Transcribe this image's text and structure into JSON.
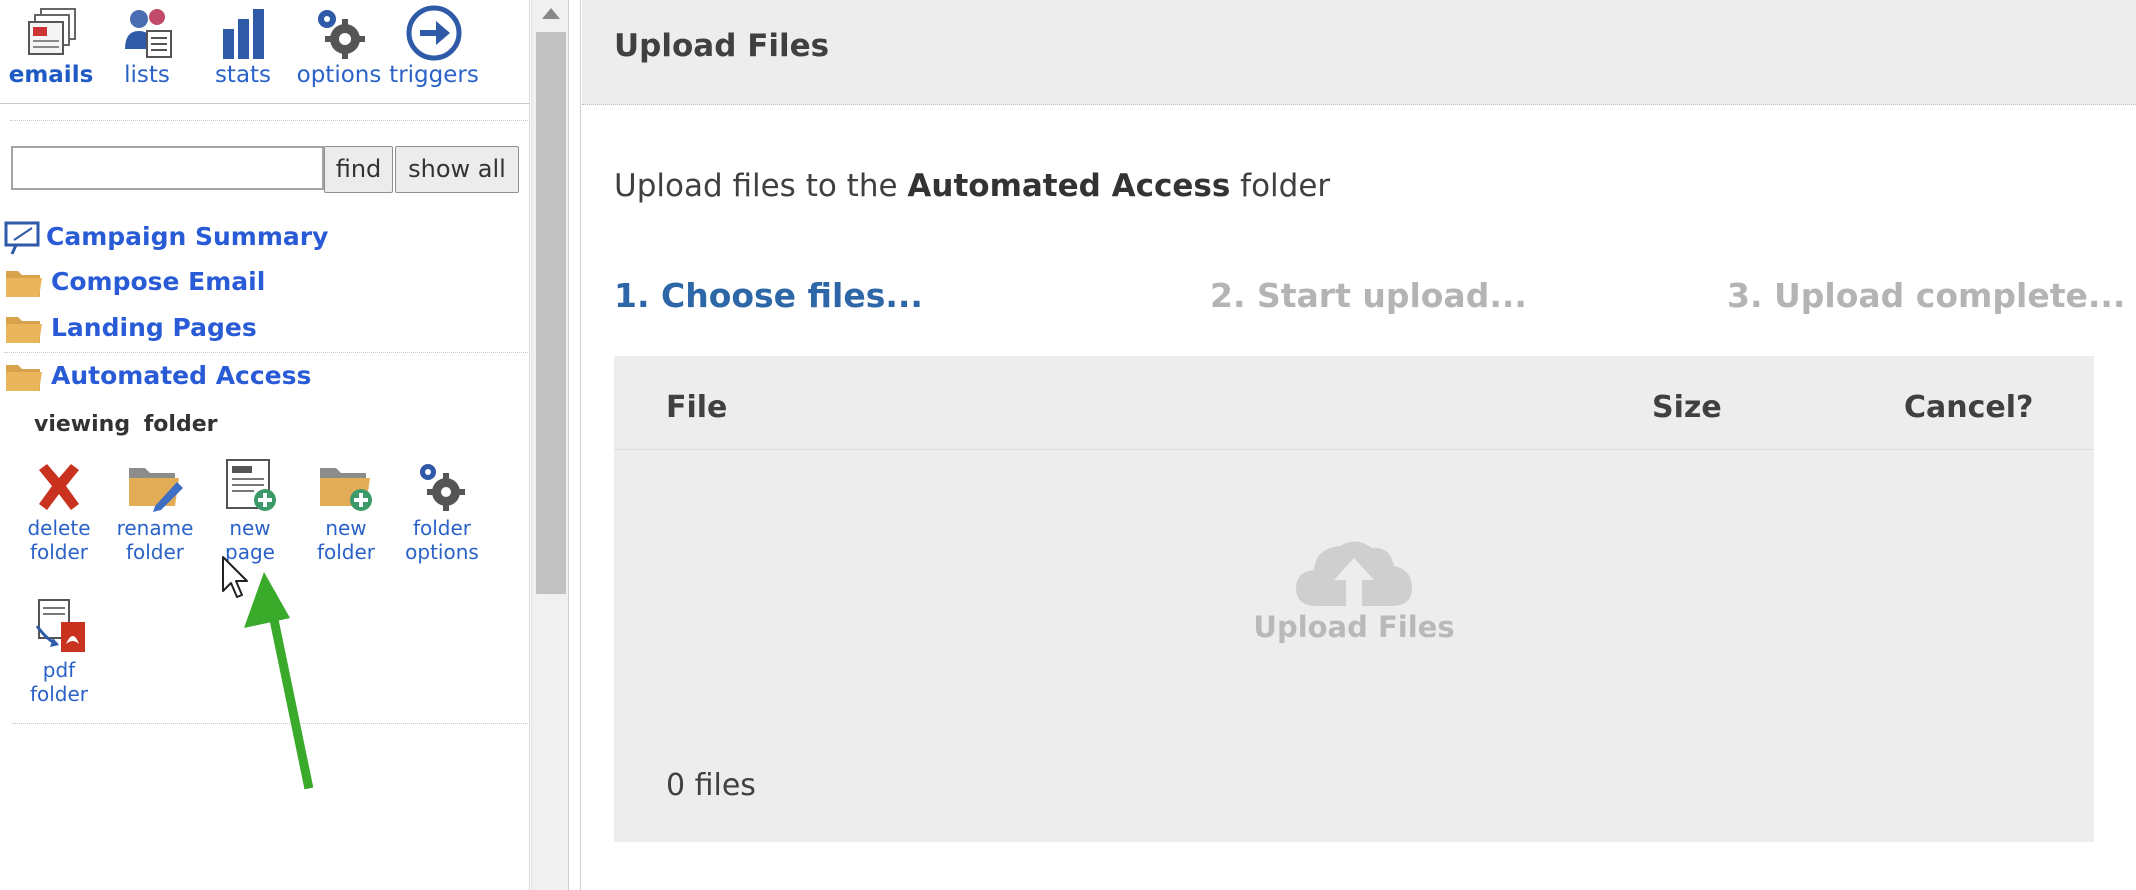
{
  "nav": {
    "items": [
      {
        "label": "emails",
        "icon": "emails-icon",
        "active": true
      },
      {
        "label": "lists",
        "icon": "lists-icon"
      },
      {
        "label": "stats",
        "icon": "stats-icon"
      },
      {
        "label": "options",
        "icon": "options-gear-icon"
      },
      {
        "label": "triggers",
        "icon": "triggers-arrow-icon"
      }
    ]
  },
  "search": {
    "value": "",
    "placeholder": "",
    "find_label": "find",
    "show_all_label": "show all"
  },
  "tree": {
    "items": [
      {
        "label": "Campaign Summary",
        "icon": "campaign-summary-icon"
      },
      {
        "label": "Compose Email",
        "icon": "folder-icon"
      },
      {
        "label": "Landing Pages",
        "icon": "folder-icon"
      },
      {
        "label": "Automated Access",
        "icon": "folder-icon"
      }
    ]
  },
  "folder_panel": {
    "viewing_label": "viewing folder",
    "tools": [
      {
        "line1": "delete",
        "line2": "folder",
        "icon": "delete-x-icon"
      },
      {
        "line1": "rename",
        "line2": "folder",
        "icon": "rename-folder-icon"
      },
      {
        "line1": "new",
        "line2": "page",
        "icon": "new-page-icon"
      },
      {
        "line1": "new",
        "line2": "folder",
        "icon": "new-folder-icon"
      },
      {
        "line1": "folder",
        "line2": "options",
        "icon": "folder-options-icon"
      },
      {
        "line1": "pdf",
        "line2": "folder",
        "icon": "pdf-folder-icon"
      }
    ]
  },
  "main": {
    "title": "Upload Files",
    "intro_prefix": "Upload files to the",
    "intro_folder": "Automated Access",
    "intro_suffix": "folder",
    "steps": [
      "1. Choose files...",
      "2. Start upload...",
      "3. Upload complete..."
    ],
    "columns": {
      "file": "File",
      "size": "Size",
      "cancel": "Cancel?"
    },
    "drop_label": "Upload Files",
    "file_count": "0 files"
  },
  "colors": {
    "link": "#2a62c8",
    "step_active": "#2e67a8",
    "step_inactive": "#b4b4b4",
    "annotation_arrow": "#3aaa2a"
  }
}
